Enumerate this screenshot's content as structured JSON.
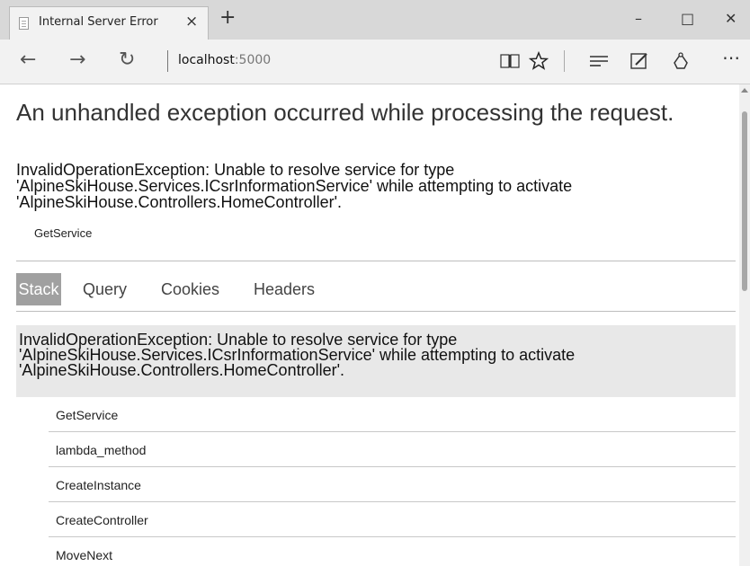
{
  "browser": {
    "tab_title": "Internal Server Error",
    "tab_close": "×",
    "new_tab": "+",
    "window_controls": {
      "minimize": "–",
      "maximize": "□",
      "close": "✕"
    },
    "nav": {
      "back": "←",
      "forward": "→",
      "refresh": "↻"
    },
    "address": {
      "host": "localhost",
      "port": ":5000"
    },
    "toolbar_icons": [
      "reading-view-icon",
      "favorite-star-icon",
      "hub-icon",
      "web-note-icon",
      "share-icon",
      "more-icon"
    ]
  },
  "page": {
    "title": "An unhandled exception occurred while processing the request.",
    "exception_message": "InvalidOperationException: Unable to resolve service for type 'AlpineSkiHouse.Services.ICsrInformationService' while attempting to activate 'AlpineSkiHouse.Controllers.HomeController'.",
    "exception_method": "GetService",
    "tabs": [
      "Stack",
      "Query",
      "Cookies",
      "Headers"
    ],
    "active_tab": "Stack",
    "stack": {
      "message": "InvalidOperationException: Unable to resolve service for type 'AlpineSkiHouse.Services.ICsrInformationService' while attempting to activate 'AlpineSkiHouse.Controllers.HomeController'.",
      "frames": [
        "GetService",
        "lambda_method",
        "CreateInstance",
        "CreateController",
        "MoveNext"
      ]
    }
  }
}
